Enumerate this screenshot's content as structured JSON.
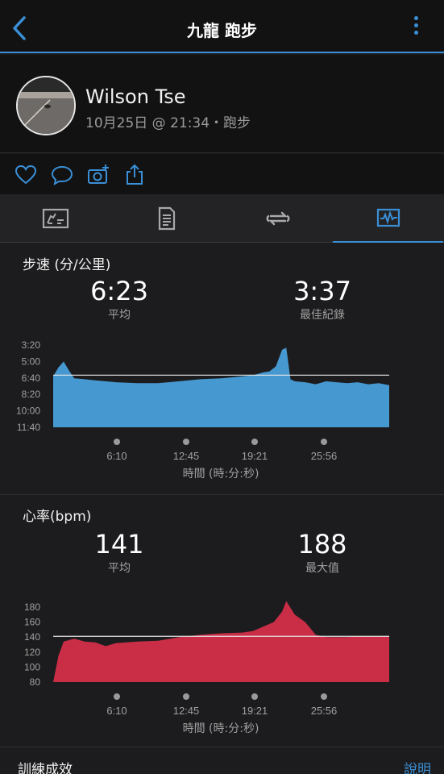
{
  "header": {
    "title": "九龍 跑步"
  },
  "profile": {
    "name": "Wilson Tse",
    "meta": "10月25日 @ 21:34・跑步"
  },
  "pace": {
    "title": "步速 (分/公里)",
    "avg_value": "6:23",
    "avg_label": "平均",
    "best_value": "3:37",
    "best_label": "最佳紀錄",
    "y_ticks": [
      "3:20",
      "5:00",
      "6:40",
      "8:20",
      "10:00",
      "11:40"
    ],
    "x_ticks": [
      "6:10",
      "12:45",
      "19:21",
      "25:56"
    ],
    "x_label": "時間 (時:分:秒)",
    "color": "#4aa3df"
  },
  "heart": {
    "title": "心率(bpm)",
    "avg_value": "141",
    "avg_label": "平均",
    "max_value": "188",
    "max_label": "最大值",
    "y_ticks": [
      "180",
      "160",
      "140",
      "120",
      "100",
      "80"
    ],
    "x_ticks": [
      "6:10",
      "12:45",
      "19:21",
      "25:56"
    ],
    "x_label": "時間 (時:分:秒)",
    "color": "#d9304a"
  },
  "bottom": {
    "title": "訓練成效",
    "link": "說明"
  },
  "chart_data": [
    {
      "type": "area",
      "title": "步速 (分/公里)",
      "xlabel": "時間 (時:分:秒)",
      "ylabel": "",
      "x_tick_labels": [
        "6:10",
        "12:45",
        "19:21",
        "25:56"
      ],
      "y_tick_labels": [
        "3:20",
        "5:00",
        "6:40",
        "8:20",
        "10:00",
        "11:40"
      ],
      "y_inverted": true,
      "ylim_minutes_per_km": [
        11.667,
        3.333
      ],
      "x_minutes": [
        0,
        0.5,
        1,
        1.5,
        2,
        3,
        4,
        5,
        6,
        8,
        10,
        12,
        14,
        16,
        18,
        19,
        20,
        20.6,
        21.2,
        21.8,
        22.2,
        22.6,
        23,
        24,
        25,
        26,
        27,
        28,
        29,
        30,
        31,
        32
      ],
      "values_minutes_per_km": [
        6.5,
        5.6,
        5.0,
        5.9,
        6.7,
        6.8,
        6.9,
        7.0,
        7.1,
        7.2,
        7.2,
        7.0,
        6.8,
        6.7,
        6.5,
        6.4,
        6.1,
        6.0,
        5.5,
        3.8,
        3.6,
        6.8,
        7.0,
        7.1,
        7.3,
        7.0,
        7.1,
        7.2,
        7.1,
        7.3,
        7.2,
        7.4
      ],
      "average_minutes_per_km": 6.383,
      "best_minutes_per_km": 3.617
    },
    {
      "type": "area",
      "title": "心率(bpm)",
      "xlabel": "時間 (時:分:秒)",
      "ylabel": "",
      "x_tick_labels": [
        "6:10",
        "12:45",
        "19:21",
        "25:56"
      ],
      "ylim": [
        80,
        180
      ],
      "x_minutes": [
        0,
        0.5,
        1,
        2,
        3,
        4,
        5,
        6,
        8,
        10,
        12,
        14,
        16,
        18,
        19,
        20,
        21,
        21.8,
        22.2,
        23,
        24,
        25,
        26,
        27,
        28,
        29,
        30,
        31,
        32
      ],
      "values_bpm": [
        80,
        115,
        134,
        138,
        134,
        133,
        128,
        132,
        134,
        135,
        140,
        143,
        145,
        146,
        148,
        154,
        160,
        174,
        188,
        170,
        160,
        143,
        140,
        140,
        140,
        141,
        141,
        141,
        141
      ],
      "average_bpm": 141,
      "max_bpm": 188
    }
  ]
}
